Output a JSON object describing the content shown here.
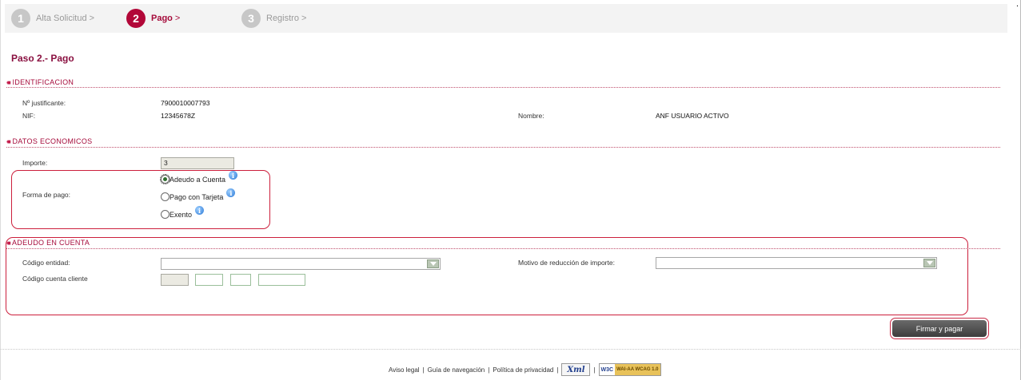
{
  "steps": [
    {
      "number": "1",
      "label": "Alta Solicitud",
      "arrow": ">",
      "active": false
    },
    {
      "number": "2",
      "label": "Pago",
      "arrow": ">",
      "active": true
    },
    {
      "number": "3",
      "label": "Registro",
      "arrow": ">",
      "active": false
    }
  ],
  "page_title": "Paso 2.- Pago",
  "identificacion": {
    "header": "IDENTIFICACION",
    "justificante_label": "Nº justificante:",
    "justificante_value": "7900010007793",
    "nif_label": "NIF:",
    "nif_value": "12345678Z",
    "nombre_label": "Nombre:",
    "nombre_value": "ANF USUARIO ACTIVO"
  },
  "datos_economicos": {
    "header": "DATOS ECONOMICOS",
    "importe_label": "Importe:",
    "importe_value": "3",
    "forma_pago_label": "Forma de pago:",
    "options": [
      {
        "label": "Adeudo a Cuenta",
        "checked": true
      },
      {
        "label": "Pago con Tarjeta",
        "checked": false
      },
      {
        "label": "Exento",
        "checked": false
      }
    ]
  },
  "adeudo": {
    "header": "ADEUDO EN CUENTA",
    "codigo_entidad_label": "Código entidad:",
    "codigo_entidad_value": "",
    "motivo_label": "Motivo de reducción de importe:",
    "motivo_value": "",
    "cuenta_label": "Código cuenta cliente"
  },
  "submit_label": "Firmar y pagar",
  "footer": {
    "links": [
      "Aviso legal",
      "Guía de navegación",
      "Política de privacidad"
    ],
    "separator": "|",
    "xml_badge": "Xml",
    "w3c": "W3C",
    "wai": "WAI-AA WCAG 1.0"
  },
  "corner_mark": "."
}
